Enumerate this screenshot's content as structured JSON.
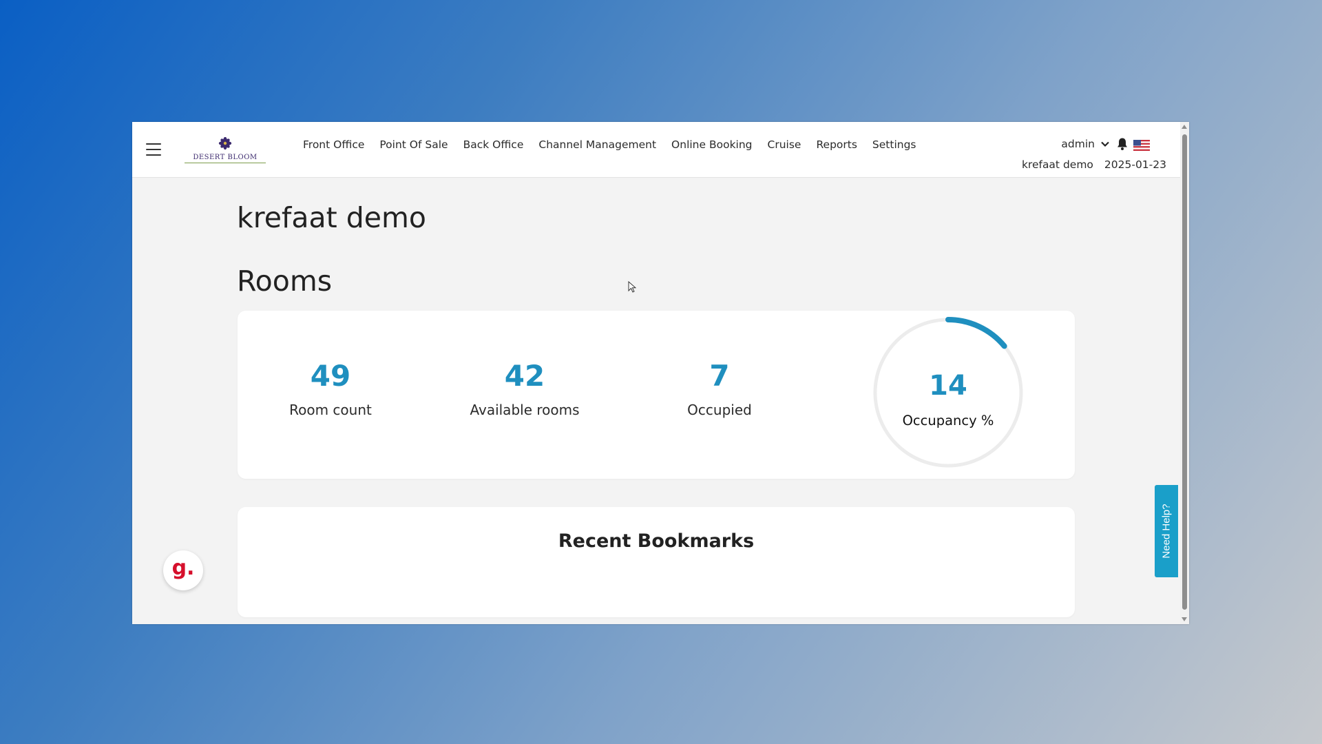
{
  "app": {
    "logo_text": "DESERT BLOOM"
  },
  "nav": {
    "items": [
      {
        "label": "Front Office"
      },
      {
        "label": "Point Of Sale"
      },
      {
        "label": "Back Office"
      },
      {
        "label": "Channel Management"
      },
      {
        "label": "Online Booking"
      },
      {
        "label": "Cruise"
      },
      {
        "label": "Reports"
      },
      {
        "label": "Settings"
      }
    ]
  },
  "user": {
    "name": "admin",
    "property": "krefaat demo",
    "date": "2025-01-23"
  },
  "page": {
    "title": "krefaat demo",
    "section_title": "Rooms"
  },
  "rooms": {
    "room_count": {
      "value": "49",
      "label": "Room count"
    },
    "available": {
      "value": "42",
      "label": "Available rooms"
    },
    "occupied": {
      "value": "7",
      "label": "Occupied"
    },
    "occupancy": {
      "value": "14",
      "label": "Occupancy %",
      "percent": 14
    }
  },
  "bookmarks": {
    "title": "Recent Bookmarks"
  },
  "help": {
    "label": "Need Help?"
  },
  "badge": {
    "text": "g."
  },
  "colors": {
    "accent": "#1f8fbf",
    "help_tab": "#1a9fc9",
    "badge_red": "#d6102c"
  },
  "icons": [
    "menu-icon",
    "chevron-down-icon",
    "bell-icon",
    "us-flag-icon",
    "mouse-cursor-icon"
  ]
}
